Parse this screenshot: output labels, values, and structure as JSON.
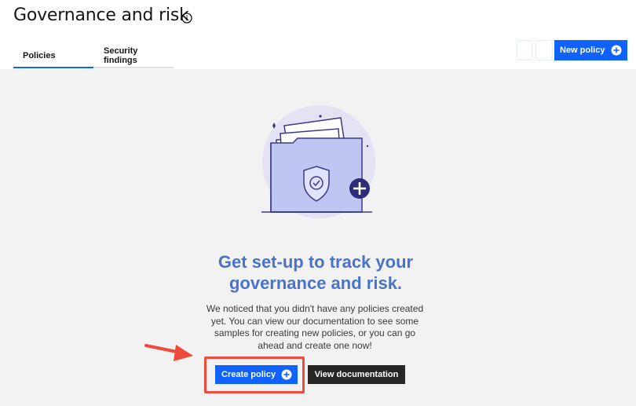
{
  "page": {
    "title": "Governance and risk",
    "title_icon": "info-icon"
  },
  "tabs": [
    {
      "label": "Policies",
      "active": true
    },
    {
      "label": "Security findings",
      "active": false
    }
  ],
  "toolbar": {
    "new_policy_label": "New policy",
    "new_policy_icon": "add-circle-icon"
  },
  "empty_state": {
    "illustration": "folder-shield-illustration",
    "headline": "Get set-up to track your governance and risk.",
    "description": "We noticed that you didn't have any policies created yet. You can view our documentation to see some samples for creating new policies, or you can go ahead and create one now!",
    "create_label": "Create policy",
    "create_icon": "add-circle-icon",
    "docs_label": "View documentation"
  },
  "annotation": {
    "highlight_color": "#ef4a3c"
  },
  "colors": {
    "primary": "#0f62fe",
    "headline": "#4a74c9",
    "secondary_button": "#262626",
    "content_bg": "#f2f2f2"
  }
}
